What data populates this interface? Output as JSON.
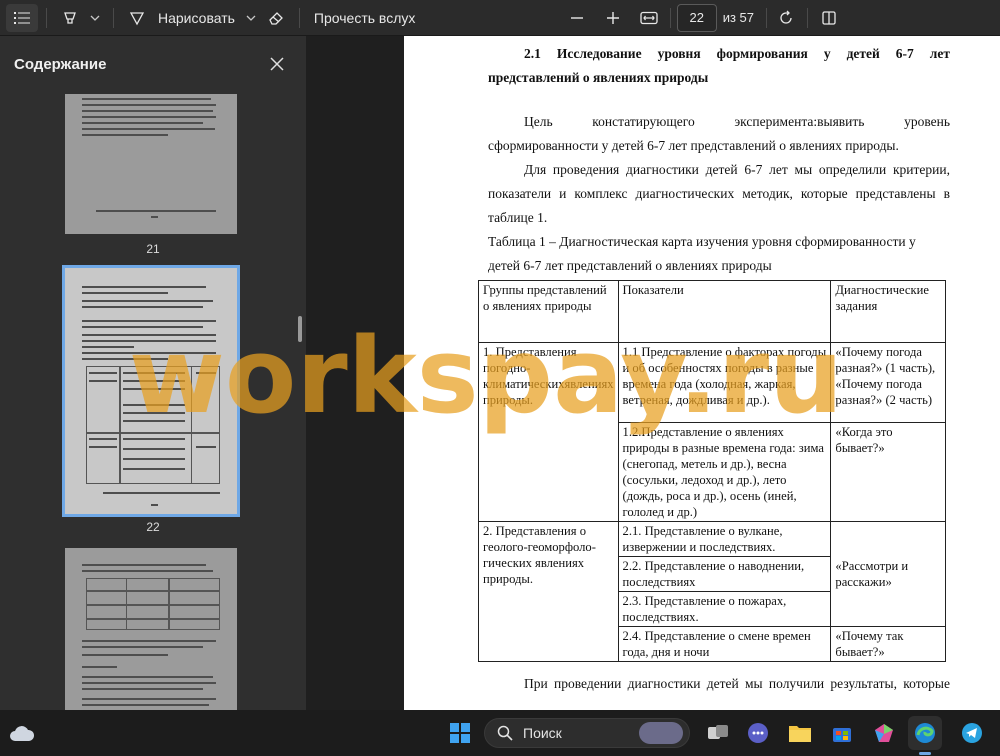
{
  "toolbar": {
    "draw_label": "Нарисовать",
    "read_aloud_label": "Прочесть вслух",
    "page_current": "22",
    "page_total": "из 57"
  },
  "sidebar": {
    "title": "Содержание",
    "thumbnails": [
      {
        "page": "21"
      },
      {
        "page": "22",
        "selected": true
      },
      {
        "page": ""
      }
    ]
  },
  "document": {
    "heading_line1": "2.1 Исследование уровня формирования у детей 6-7 лет",
    "heading_line2": "представлений о явлениях природы",
    "para1_line1": "Цель констатирующего эксперимента:выявить уровень",
    "para1_line2": "сформированности у детей 6-7 лет представлений о явлениях природы.",
    "para2_line1": "Для проведения диагностики детей 6-7 лет мы определили критерии,",
    "para2_line2": "показатели и комплекс диагностических методик, которые представлены в",
    "para2_line3": "таблице 1.",
    "table_caption_line1": "Таблица 1 – Диагностическая карта изучения уровня сформированности у",
    "table_caption_line2": "детей 6-7 лет представлений о явлениях природы",
    "table": {
      "headers": [
        "Группы представлений о явлениях природы",
        "Показатели",
        "Диагностические задания"
      ],
      "group1": "1. Представления погодно-климатическихявлениях природы.",
      "g1_ind1": "1.1 Представление о факторах погоды и об особенностях погоды в разные времена года (холодная, жаркая, ветреная, дождливая и др.).",
      "g1_task1": "«Почему погода разная?» (1 часть), «Почему погода разная?» (2 часть)",
      "g1_ind2": "1.2.Представление о явлениях природы в разные времена года: зима (снегопад, метель и др.), весна (сосульки, ледоход и др.), лето (дождь, роса и др.), осень (иней, гололед и др.)",
      "g1_task2": "«Когда это бывает?»",
      "group2": "2. Представления о геолого-геоморфоло-гических явлениях природы.",
      "g2_ind1": "2.1. Представление о вулкане, извержении и последствиях.",
      "g2_ind2": "2.2. Представление о наводнении, последствиях",
      "g2_ind3": "2.3. Представление о пожарах, последствиях.",
      "g2_task1": "«Рассмотри и расскажи»",
      "g2_ind4": "2.4. Представление о смене времен года, дня и ночи",
      "g2_task2": "«Почему так бывает?»"
    },
    "para3_line1": "При проведении диагностики детей мы получили результаты, которые"
  },
  "watermark": {
    "text": "workspay.ru"
  },
  "taskbar": {
    "search_label": "Поиск"
  },
  "colors": {
    "accent": "#6fa8e6",
    "watermark": "#e8a020"
  }
}
